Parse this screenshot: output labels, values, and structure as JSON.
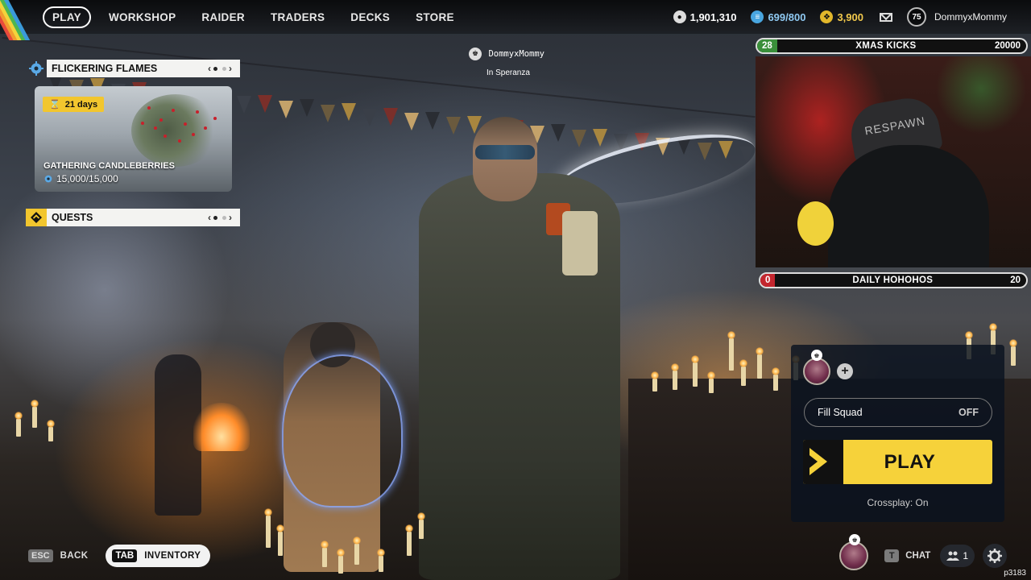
{
  "nav": {
    "items": [
      "PLAY",
      "WORKSHOP",
      "RAIDER",
      "TRADERS",
      "DECKS",
      "STORE"
    ],
    "active": "PLAY"
  },
  "currencies": {
    "coins": "1,901,310",
    "blue": "699/800",
    "gold": "3,900"
  },
  "profile": {
    "level": "75",
    "username": "DommyxMommy"
  },
  "event_panel": {
    "title": "FLICKERING FLAMES",
    "days_left": "21 days",
    "card_title": "GATHERING CANDLEBERRIES",
    "progress": "15,000/15,000"
  },
  "quests_panel": {
    "title": "QUESTS"
  },
  "player_tag": {
    "name": "DommyxMommy",
    "location": "In Speranza"
  },
  "stream_goals": {
    "top": {
      "count": "28",
      "title": "XMAS KICKS",
      "target": "20000",
      "color": "#3a8f3a"
    },
    "bottom": {
      "count": "0",
      "title": "DAILY HOHOHOS",
      "target": "20",
      "color": "#c4262e"
    },
    "webcam_chair_text": "RESPAWN"
  },
  "squad": {
    "fill_label": "Fill Squad",
    "fill_state": "OFF",
    "play_label": "PLAY",
    "crossplay": "Crossplay: On"
  },
  "bottom_bar": {
    "esc_key": "ESC",
    "back_label": "BACK",
    "tab_key": "TAB",
    "inventory_label": "INVENTORY",
    "chat_key": "T",
    "chat_label": "CHAT",
    "friends_count": "1"
  },
  "build_id": "p3183",
  "colors": {
    "accent_yellow": "#f6d23a",
    "currency_blue": "#8fc9f2",
    "currency_gold": "#f2c94c"
  }
}
